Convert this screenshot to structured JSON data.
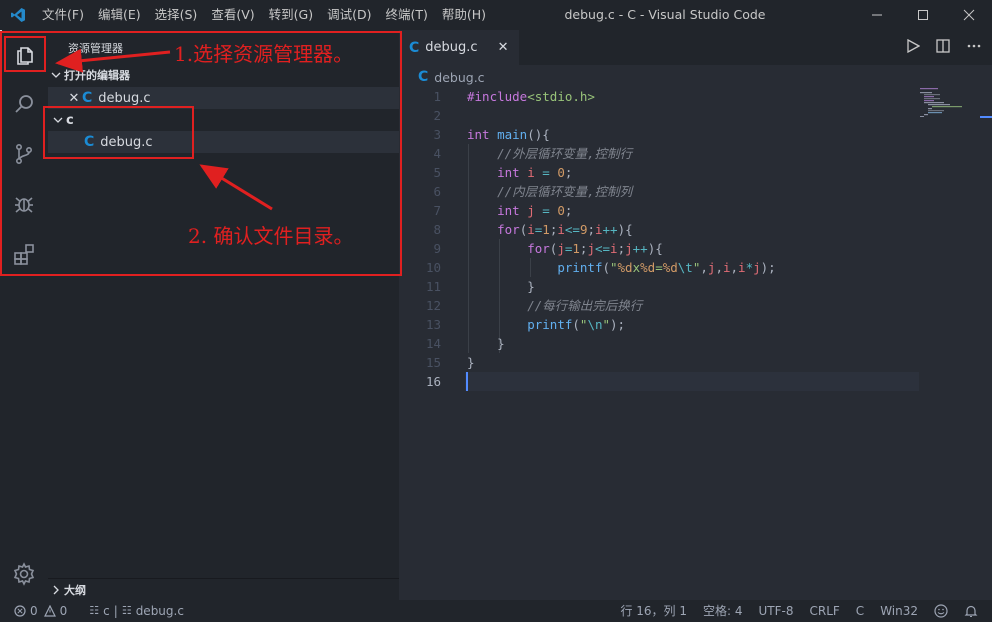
{
  "window": {
    "title": "debug.c - C - Visual Studio Code",
    "menu": [
      "文件(F)",
      "编辑(E)",
      "选择(S)",
      "查看(V)",
      "转到(G)",
      "调试(D)",
      "终端(T)",
      "帮助(H)"
    ]
  },
  "activity_bar": {
    "items": [
      "explorer-icon",
      "search-icon",
      "source-control-icon",
      "debug-icon",
      "extensions-icon"
    ],
    "bottom": "settings-gear-icon"
  },
  "sidebar": {
    "title": "资源管理器",
    "open_editors": {
      "header": "打开的编辑器",
      "files": [
        {
          "name": "debug.c",
          "icon": "C"
        }
      ]
    },
    "folder": {
      "name": "c",
      "files": [
        {
          "name": "debug.c",
          "icon": "C"
        }
      ]
    },
    "outline": "大纲"
  },
  "editor": {
    "tab": {
      "name": "debug.c",
      "icon": "C"
    },
    "breadcrumb": "debug.c",
    "lines": [
      "1",
      "2",
      "3",
      "4",
      "5",
      "6",
      "7",
      "8",
      "9",
      "10",
      "11",
      "12",
      "13",
      "14",
      "15",
      "16"
    ]
  },
  "status_bar": {
    "errors": "0",
    "warnings": "0",
    "breadcrumb_folder": "c",
    "breadcrumb_file": "debug.c",
    "position": "行 16，列 1",
    "indent": "空格: 4",
    "encoding": "UTF-8",
    "eol": "CRLF",
    "language": "C",
    "platform": "Win32"
  },
  "annotations": {
    "step1": "1.选择资源管理器。",
    "step2": "2. 确认文件目录。"
  },
  "colors": {
    "annotation": "#e02020",
    "accent": "#528bff",
    "c_icon": "#1b8bd4"
  }
}
